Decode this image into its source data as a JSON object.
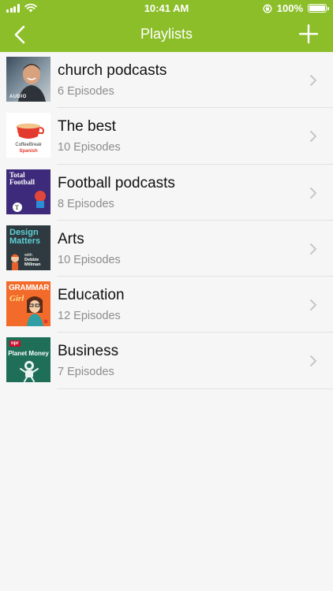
{
  "status_bar": {
    "time": "10:41 AM",
    "battery": "100%"
  },
  "nav": {
    "title": "Playlists",
    "back_icon": "chevron-left-icon",
    "add_icon": "plus-icon"
  },
  "colors": {
    "accent": "#8cbe2a",
    "background": "#f6f6f6",
    "subtitle": "#8d8d8d"
  },
  "playlists": [
    {
      "title": "church podcasts",
      "episodes": "6 Episodes",
      "art": {
        "caption": "AUDIO"
      }
    },
    {
      "title": "The best",
      "episodes": "10 Episodes",
      "art": {
        "line1": "CoffeeBreak",
        "line2": "Spanish"
      }
    },
    {
      "title": "Football podcasts",
      "episodes": "8 Episodes",
      "art": {
        "line1": "Total",
        "line2": "Football"
      }
    },
    {
      "title": "Arts",
      "episodes": "10 Episodes",
      "art": {
        "line1": "Design",
        "line2": "Matters",
        "line3": "with",
        "line4": "Debbie",
        "line5": "Millman"
      }
    },
    {
      "title": "Education",
      "episodes": "12 Episodes",
      "art": {
        "line1": "GRAMMAR",
        "line2": "Girl"
      }
    },
    {
      "title": "Business",
      "episodes": "7 Episodes",
      "art": {
        "line1": "npr",
        "line2": "Planet Money"
      }
    }
  ]
}
